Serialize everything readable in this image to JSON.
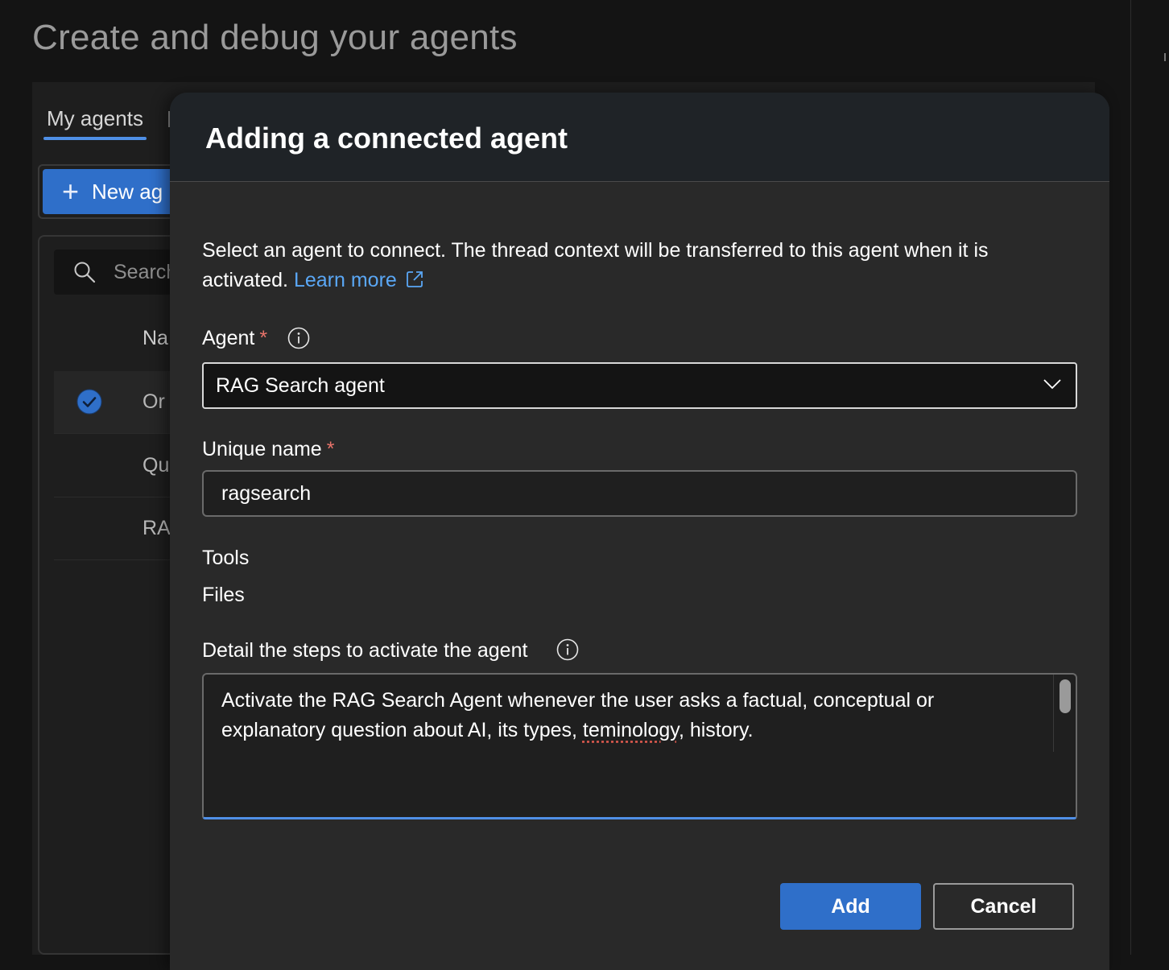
{
  "page": {
    "title": "Create and debug your agents"
  },
  "tabs": {
    "my_agents": "My agents"
  },
  "toolbar": {
    "new_agent_label": "New ag"
  },
  "list": {
    "search_placeholder": "Search",
    "column_name": "Na",
    "rows": [
      {
        "label": "Or",
        "selected": true
      },
      {
        "label": "Qu",
        "selected": false
      },
      {
        "label": "RA",
        "selected": false
      }
    ]
  },
  "dialog": {
    "title": "Adding a connected agent",
    "description": "Select an agent to connect. The thread context will be transferred to this agent when it is activated.",
    "learn_more": "Learn more",
    "agent_label": "Agent",
    "agent_value": "RAG Search agent",
    "unique_name_label": "Unique name",
    "unique_name_value": "ragsearch",
    "tools_label": "Tools",
    "files_label": "Files",
    "steps_label": "Detail the steps to activate the agent",
    "steps_line1": "Activate the RAG Search Agent whenever the user asks a factual, conceptual or",
    "steps_line2a": "explanatory question about AI, its types, ",
    "steps_misspelled": "teminology",
    "steps_line2b": ", history.",
    "add_button": "Add",
    "cancel_button": "Cancel",
    "required_marker": "*"
  },
  "colors": {
    "accent": "#2f6fc9",
    "link": "#5aa7f5",
    "required": "#e8736a",
    "dialog_bg": "#292929",
    "header_bg": "#1f2327"
  }
}
